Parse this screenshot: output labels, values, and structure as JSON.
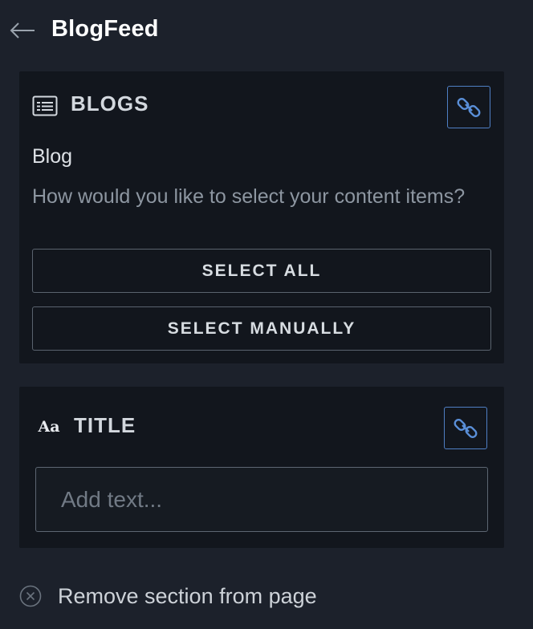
{
  "header": {
    "title": "BlogFeed",
    "back_icon": "arrow-left-icon"
  },
  "blogs_card": {
    "heading": "BLOGS",
    "icon": "list-icon",
    "link_icon": "link-icon",
    "field_label": "Blog",
    "question": "How would you like to select your content items?",
    "select_all_label": "SELECT ALL",
    "select_manually_label": "SELECT MANUALLY"
  },
  "title_card": {
    "heading": "TITLE",
    "icon_text": "Aa",
    "link_icon": "link-icon",
    "input_value": "",
    "input_placeholder": "Add text..."
  },
  "footer": {
    "remove_label": "Remove section from page",
    "remove_icon": "close-circle-icon"
  },
  "colors": {
    "background": "#1c212b",
    "card": "#12161d",
    "accent_link": "#4f7fc4"
  }
}
